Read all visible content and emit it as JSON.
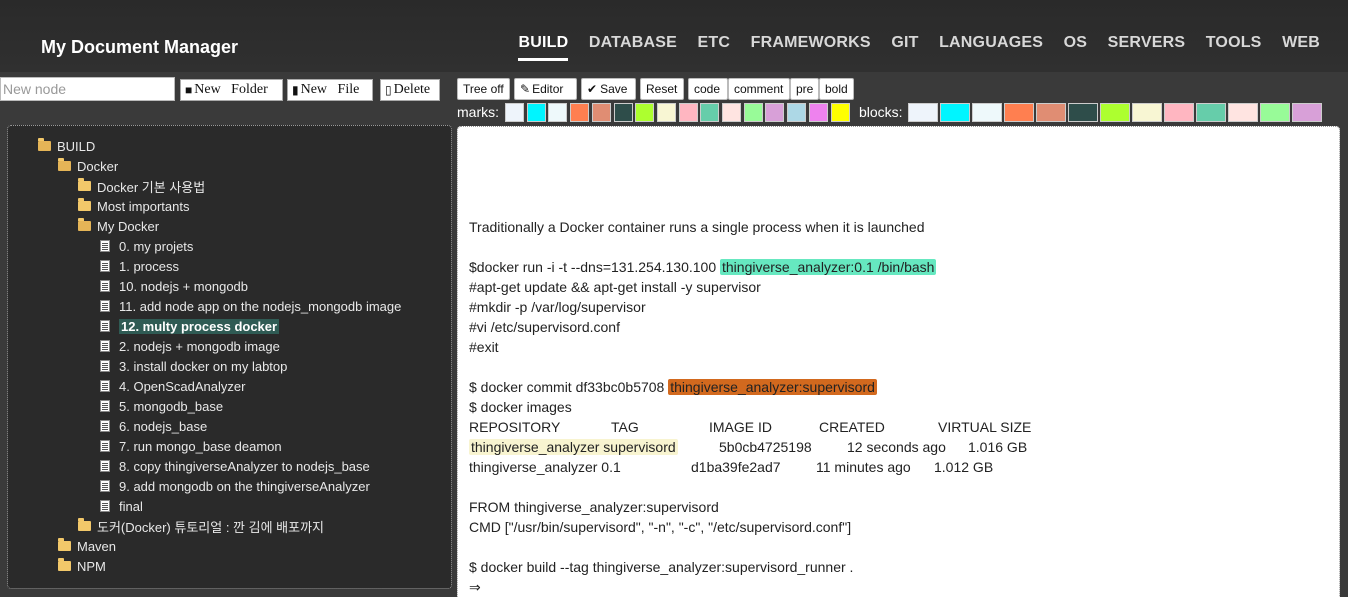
{
  "app": {
    "title": "My Document Manager"
  },
  "nav": [
    "BUILD",
    "DATABASE",
    "ETC",
    "FRAMEWORKS",
    "GIT",
    "LANGUAGES",
    "OS",
    "SERVERS",
    "TOOLS",
    "WEB"
  ],
  "left_toolbar": {
    "new_node_placeholder": "New node",
    "new_folder": "New Folder",
    "new_file": "New File",
    "delete": "Delete"
  },
  "tree": {
    "root": "BUILD",
    "docker": "Docker",
    "docker_basic": "Docker 기본 사용법",
    "most_importants": "Most importants",
    "my_docker": "My Docker",
    "files": [
      "0. my projets",
      "1. process",
      "10. nodejs + mongodb",
      "11. add node app on the nodejs_mongodb image",
      "12. multy process docker",
      "2. nodejs + mongodb image",
      "3. install docker on my labtop",
      "4. OpenScadAnalyzer",
      "5. mongodb_base",
      "6. nodejs_base",
      "7. run mongo_base deamon",
      "8. copy thingiverseAnalyzer to nodejs_base",
      "9. add mongodb on the thingiverseAnalyzer",
      "final"
    ],
    "tutorial": "도커(Docker) 튜토리얼 : 깐 김에 배포까지",
    "maven": "Maven",
    "npm": "NPM"
  },
  "editor_toolbar": {
    "tree_off": "Tree off",
    "editor": "Editor",
    "save": "Save",
    "reset": "Reset",
    "code": "code",
    "comment": "comment",
    "pre": "pre",
    "bold": "bold",
    "marks_label": "marks:",
    "blocks_label": "blocks:"
  },
  "mark_colors": [
    "#eef4fb",
    "#00f5ff",
    "#eef9fb",
    "#ff7f50",
    "#e08d73",
    "#2e4d4a",
    "#adff2f",
    "#f8f6d3",
    "#ffb6c1",
    "#66cdaa",
    "#ffe4e1",
    "#98fb98",
    "#d8a0d8",
    "#add8e6",
    "#ee82ee",
    "#ffff00"
  ],
  "block_colors": [
    "#eef4fb",
    "#00f5ff",
    "#eef9fb",
    "#ff7f50",
    "#e08d73",
    "#2e4d4a",
    "#adff2f",
    "#f8f6d3",
    "#ffb6c1",
    "#66cdaa",
    "#ffe4e1",
    "#98fb98",
    "#d8a0d8"
  ],
  "document": {
    "l1": "Traditionally a Docker container runs a single process when it is launched",
    "l2a": "$docker run -i -t --dns=131.254.130.100 ",
    "l2b": "thingiverse_analyzer:0.1 /bin/bash",
    "l3": "#apt-get update && apt-get install -y supervisor",
    "l4": "#mkdir -p /var/log/supervisor",
    "l5": "#vi /etc/supervisord.conf",
    "l6": "#exit",
    "l7a": "$ docker commit df33bc0b5708 ",
    "l7b": "thingiverse_analyzer:supervisord",
    "l8": "$ docker images",
    "h_repo": "REPOSITORY",
    "h_tag": "TAG",
    "h_id": "IMAGE ID",
    "h_created": "CREATED",
    "h_size": "VIRTUAL SIZE",
    "r1_repo": "thingiverse_analyzer supervisord",
    "r1_id": "5b0cb4725198",
    "r1_created": "12 seconds ago",
    "r1_size": "1.016 GB",
    "r2_repo": "thingiverse_analyzer 0.1",
    "r2_id": "d1ba39fe2ad7",
    "r2_created": "11 minutes ago",
    "r2_size": "1.012 GB",
    "l9": "FROM thingiverse_analyzer:supervisord",
    "l10": "CMD [\"/usr/bin/supervisord\", \"-n\", \"-c\", \"/etc/supervisord.conf\"]",
    "l11": "$ docker build --tag thingiverse_analyzer:supervisord_runner .",
    "l12": "⇒"
  }
}
